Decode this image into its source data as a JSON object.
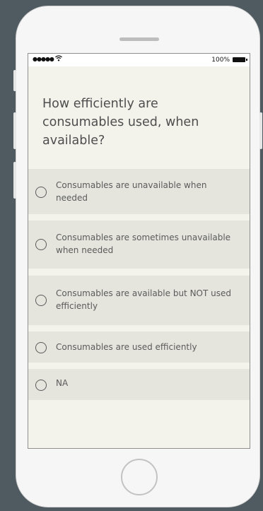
{
  "status_bar": {
    "signal": "●●●●●",
    "battery_percent": "100%"
  },
  "question": "How efficiently are consumables used, when available?",
  "options": [
    {
      "label": "Consumables are unavailable when needed",
      "selected": false
    },
    {
      "label": "Consumables are sometimes unavailable when needed",
      "selected": false
    },
    {
      "label": "Consumables are available but NOT used efficiently",
      "selected": false
    },
    {
      "label": "Consumables are used efficiently",
      "selected": false
    },
    {
      "label": "NA",
      "selected": false
    }
  ],
  "icons": [
    "wifi-icon",
    "battery-icon",
    "radio-icon",
    "home-button-icon"
  ]
}
